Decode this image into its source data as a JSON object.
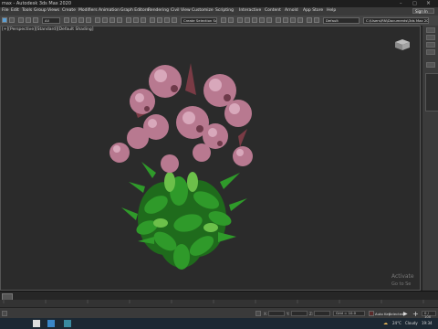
{
  "window": {
    "title": "max - Autodesk 3ds Max 2020"
  },
  "menu": {
    "items": [
      "File",
      "Edit",
      "Tools",
      "Group",
      "Views",
      "Create",
      "Modifiers",
      "Animation",
      "Graph Editors",
      "Rendering",
      "Civil View",
      "Customize",
      "Scripting",
      "Interactive",
      "Content",
      "Arnold",
      "App Store",
      "Help"
    ],
    "sign_in": "Sign In"
  },
  "toolbar": {
    "selection_filter": "All",
    "selection_set": "Create Selection Se",
    "workspace": "Default",
    "project_path": "C:\\Users\\RN\\Documents\\3ds Max 2020"
  },
  "viewport": {
    "label": "[+][Perspective][Standard][Default Shading]",
    "watermark_title": "Activate",
    "watermark_sub": "Go to Se"
  },
  "timeline": {
    "ticks": [
      0,
      10,
      20,
      30,
      40,
      50,
      60,
      70,
      80,
      90,
      100
    ]
  },
  "statusbar": {
    "frame": "0 / 100",
    "x_label": "X:",
    "y_label": "Y:",
    "z_label": "Z:",
    "add_time_tag": "Add Time Tag",
    "auto_key": "Auto Key",
    "set_key": "Set Key",
    "selected": "Selected",
    "grid": "Grid = 10.0"
  },
  "taskbar": {
    "weather_temp": "24°C",
    "weather_desc": "Cloudy",
    "time": "19:34"
  },
  "colors": {
    "viewport_bg": "#2b2b2b",
    "accent": "#5aa0d6",
    "leaf": "#2f9a2a",
    "flower": "#b87990"
  }
}
